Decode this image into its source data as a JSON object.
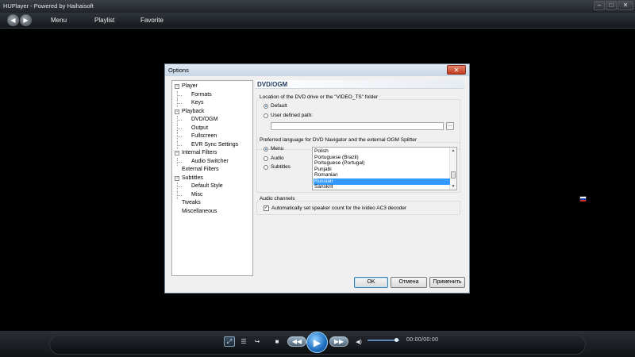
{
  "app": {
    "title": "HUPlayer - Powered by Haihaisoft",
    "menu": [
      "Menu",
      "Playlist",
      "Favorite"
    ],
    "window_buttons": [
      "–",
      "□",
      "✕"
    ],
    "nav": [
      "◀",
      "▶"
    ]
  },
  "controls": {
    "time": "00:00/00:00",
    "play_icon": "▶",
    "rewind_icon": "◀◀",
    "forward_icon": "▶▶",
    "stop_icon": "■",
    "volume_icon": "◀)",
    "playlist_icon": "☰",
    "repeat_icon": "↪",
    "fullscreen_icon": "⤢",
    "volume_level": 0.9
  },
  "dialog": {
    "title": "Options",
    "close_label": "✕",
    "tree": [
      {
        "label": "Player",
        "level": 0,
        "expanded": true
      },
      {
        "label": "Formats",
        "level": 1
      },
      {
        "label": "Keys",
        "level": 1
      },
      {
        "label": "Playback",
        "level": 0,
        "expanded": true
      },
      {
        "label": "DVD/OGM",
        "level": 1
      },
      {
        "label": "Output",
        "level": 1
      },
      {
        "label": "Fullscreen",
        "level": 1
      },
      {
        "label": "EVR Sync Settings",
        "level": 1
      },
      {
        "label": "Internal Filters",
        "level": 0,
        "expanded": true
      },
      {
        "label": "Audio Switcher",
        "level": 1
      },
      {
        "label": "External Filters",
        "level": 0
      },
      {
        "label": "Subtitles",
        "level": 0,
        "expanded": true
      },
      {
        "label": "Default Style",
        "level": 1
      },
      {
        "label": "Misc",
        "level": 1
      },
      {
        "label": "Tweaks",
        "level": 0
      },
      {
        "label": "Miscellaneous",
        "level": 0
      }
    ],
    "panel": {
      "title": "DVD/OGM",
      "location_group": "Location of the DVD drive or the \"VIDEO_TS\" folder",
      "default_label": "Default",
      "user_path_label": "User defined path:",
      "path_value": "",
      "browse_label": "...",
      "language_group": "Preferred language for DVD Navigator and the external OGM Splitter",
      "language_targets": [
        "Menu",
        "Audio",
        "Subtitles"
      ],
      "languages": [
        "Polish",
        "Portuguese (Brazil)",
        "Portuguese (Portugal)",
        "Punjabi",
        "Romanian",
        "Russian",
        "Sanskrit"
      ],
      "selected_language": "Russian",
      "audio_group": "Audio channels",
      "speaker_label": "Automatically set speaker count for the ivideo AC3 decoder",
      "speaker_checked": true
    },
    "buttons": {
      "ok": "OK",
      "cancel": "Отмена",
      "apply": "Применить"
    }
  },
  "colors": {
    "accent": "#3399ff",
    "dialog_bg": "#f0f0f0"
  }
}
